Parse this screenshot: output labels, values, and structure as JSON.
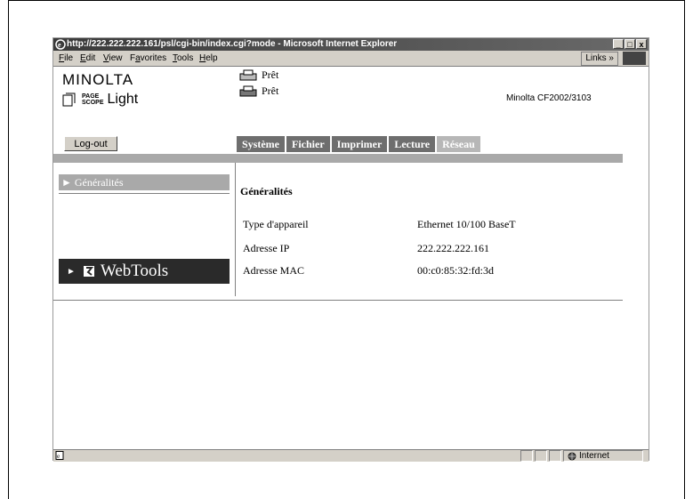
{
  "window": {
    "title": "http://222.222.222.161/psl/cgi-bin/index.cgi?mode - Microsoft Internet Explorer",
    "minimize": "_",
    "maximize": "□",
    "close": "x"
  },
  "menubar": {
    "items": [
      {
        "u": "F",
        "rest": "ile"
      },
      {
        "u": "E",
        "rest": "dit"
      },
      {
        "u": "V",
        "rest": "iew"
      },
      {
        "pre": "F",
        "u": "a",
        "rest": "vorites"
      },
      {
        "u": "T",
        "rest": "ools"
      },
      {
        "u": "H",
        "rest": "elp"
      }
    ],
    "links": "Links »"
  },
  "header": {
    "brand": "MINOLTA",
    "pagescope_small_1": "PAGE",
    "pagescope_small_2": "SCOPE",
    "pagescope_light": "Light",
    "status_1": "Prêt",
    "status_2": "Prêt",
    "model": "Minolta CF2002/3103"
  },
  "logout_label": "Log-out",
  "tabs": [
    {
      "label": "Système",
      "enabled": true
    },
    {
      "label": "Fichier",
      "enabled": true
    },
    {
      "label": "Imprimer",
      "enabled": true
    },
    {
      "label": "Lecture",
      "enabled": true
    },
    {
      "label": "Réseau",
      "enabled": false
    }
  ],
  "sidebar": {
    "item_label": "► Généralités",
    "webtools_arrow": "►",
    "webtools_label": "WebTools"
  },
  "content": {
    "title": "Généralités",
    "rows": [
      {
        "label": "Type d'appareil",
        "value": "Ethernet 10/100 BaseT"
      },
      {
        "label": "Adresse IP",
        "value": "222.222.222.161"
      },
      {
        "label": "Adresse MAC",
        "value": "00:c0:85:32:fd:3d"
      }
    ]
  },
  "statusbar": {
    "zone": "Internet"
  },
  "colors": {
    "tab_active": "#6e6e6e",
    "tab_disabled": "#b7b7b7",
    "bar_grey": "#a9a9a9",
    "webtools_bg": "#2a2a2a"
  }
}
